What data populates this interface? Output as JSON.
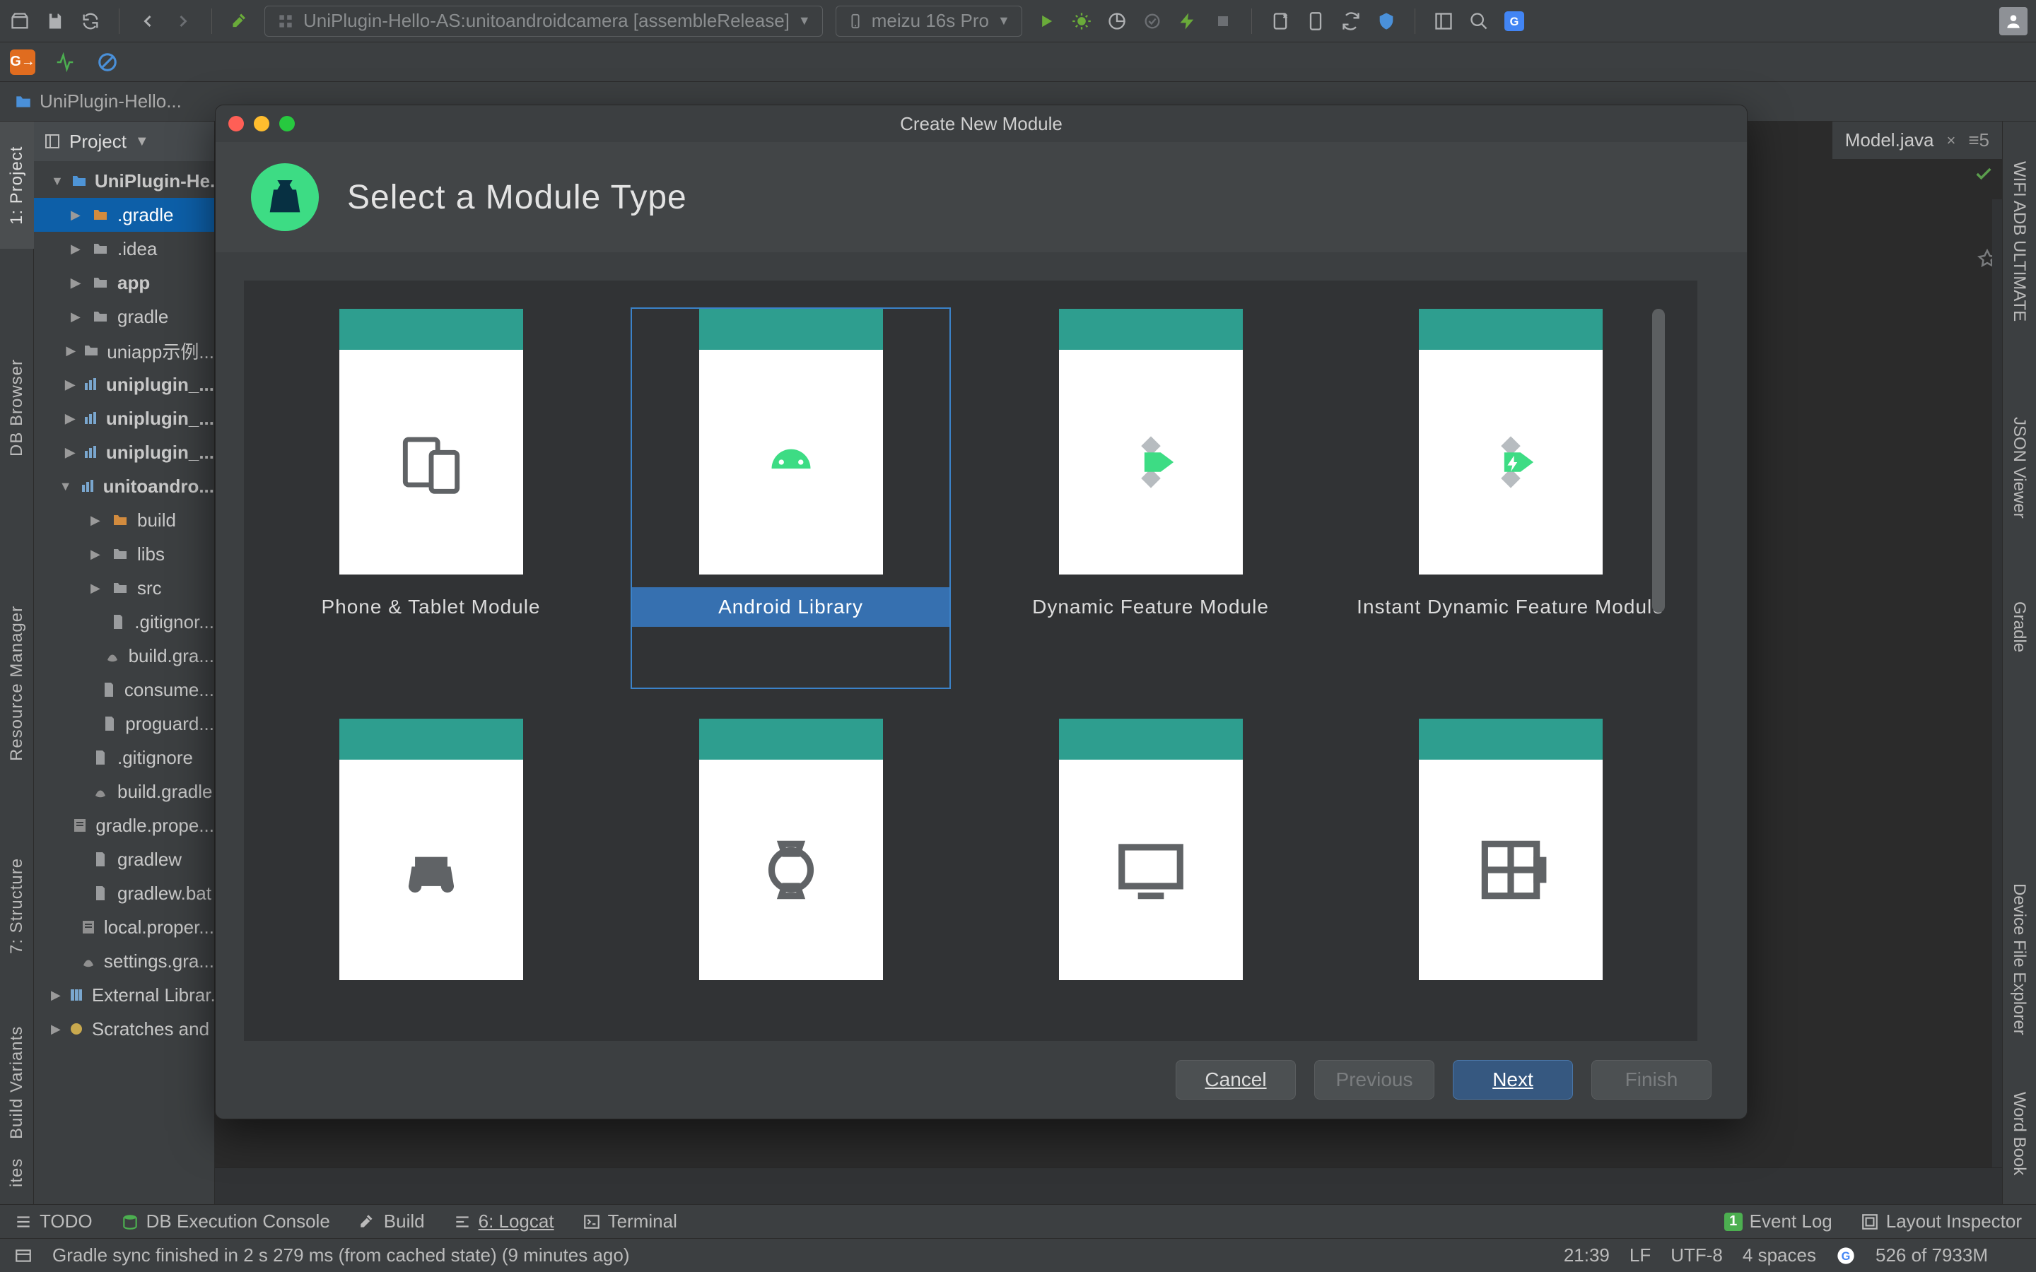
{
  "toolbar": {
    "config": "UniPlugin-Hello-AS:unitoandroidcamera [assembleRelease]",
    "device": "meizu 16s Pro"
  },
  "breadcrumb": {
    "root": "UniPlugin-Hello..."
  },
  "project": {
    "view_label": "Project",
    "items": [
      {
        "label": "UniPlugin-He...",
        "icon": "folder-blue",
        "caret": "▼",
        "bold": true,
        "ind": 0
      },
      {
        "label": ".gradle",
        "icon": "folder-orange",
        "caret": "▶",
        "ind": 1,
        "sel": true
      },
      {
        "label": ".idea",
        "icon": "folder-grey",
        "caret": "▶",
        "ind": 1
      },
      {
        "label": "app",
        "icon": "folder-grey",
        "caret": "▶",
        "ind": 1,
        "bold": true
      },
      {
        "label": "gradle",
        "icon": "folder-grey",
        "caret": "▶",
        "ind": 1
      },
      {
        "label": "uniapp示例...",
        "icon": "folder-grey",
        "caret": "▶",
        "ind": 1
      },
      {
        "label": "uniplugin_...",
        "icon": "module",
        "caret": "▶",
        "ind": 1,
        "bold": true
      },
      {
        "label": "uniplugin_...",
        "icon": "module",
        "caret": "▶",
        "ind": 1,
        "bold": true
      },
      {
        "label": "uniplugin_...",
        "icon": "module",
        "caret": "▶",
        "ind": 1,
        "bold": true
      },
      {
        "label": "unitoandro...",
        "icon": "module",
        "caret": "▼",
        "ind": 1,
        "bold": true
      },
      {
        "label": "build",
        "icon": "folder-orange",
        "caret": "▶",
        "ind": 2
      },
      {
        "label": "libs",
        "icon": "folder-grey",
        "caret": "▶",
        "ind": 2
      },
      {
        "label": "src",
        "icon": "folder-grey",
        "caret": "▶",
        "ind": 2
      },
      {
        "label": ".gitignor...",
        "icon": "file",
        "caret": "",
        "ind": 2
      },
      {
        "label": "build.gra...",
        "icon": "gradle",
        "caret": "",
        "ind": 2
      },
      {
        "label": "consume...",
        "icon": "file",
        "caret": "",
        "ind": 2
      },
      {
        "label": "proguard...",
        "icon": "file",
        "caret": "",
        "ind": 2
      },
      {
        "label": ".gitignore",
        "icon": "file",
        "caret": "",
        "ind": 1
      },
      {
        "label": "build.gradle",
        "icon": "gradle",
        "caret": "",
        "ind": 1
      },
      {
        "label": "gradle.prope...",
        "icon": "props",
        "caret": "",
        "ind": 1
      },
      {
        "label": "gradlew",
        "icon": "file",
        "caret": "",
        "ind": 1
      },
      {
        "label": "gradlew.bat",
        "icon": "file",
        "caret": "",
        "ind": 1
      },
      {
        "label": "local.proper...",
        "icon": "props",
        "caret": "",
        "ind": 1
      },
      {
        "label": "settings.gra...",
        "icon": "gradle",
        "caret": "",
        "ind": 1
      },
      {
        "label": "External Librar...",
        "icon": "lib",
        "caret": "▶",
        "ind": 0
      },
      {
        "label": "Scratches and ...",
        "icon": "scratch",
        "caret": "▶",
        "ind": 0
      }
    ]
  },
  "left_tabs": {
    "project": "1: Project",
    "db": "DB Browser",
    "res": "Resource Manager",
    "structure": "7: Structure",
    "build": "Build Variants",
    "fav": "ites"
  },
  "right_tabs": {
    "wifi": "WIFI ADB ULTIMATE",
    "json": "JSON Viewer",
    "gradle": "Gradle",
    "device": "Device File Explorer",
    "word": "Word Book"
  },
  "editor": {
    "tab": "Model.java",
    "split_indicator": "≡5"
  },
  "dialog": {
    "title": "Create New Module",
    "heading": "Select a Module Type",
    "modules": [
      "Phone & Tablet Module",
      "Android Library",
      "Dynamic Feature Module",
      "Instant Dynamic Feature Module"
    ],
    "buttons": {
      "cancel": "Cancel",
      "previous": "Previous",
      "next": "Next",
      "finish": "Finish"
    }
  },
  "bottom": {
    "todo": "TODO",
    "db": "DB Execution Console",
    "build": "Build",
    "logcat": "6: Logcat",
    "terminal": "Terminal",
    "event": "Event Log",
    "event_count": "1",
    "layout": "Layout Inspector"
  },
  "status": {
    "msg": "Gradle sync finished in 2 s 279 ms (from cached state) (9 minutes ago)",
    "pos": "21:39",
    "sep": "LF",
    "enc": "UTF-8",
    "indent": "4 spaces",
    "mem": "526 of 7933M"
  }
}
